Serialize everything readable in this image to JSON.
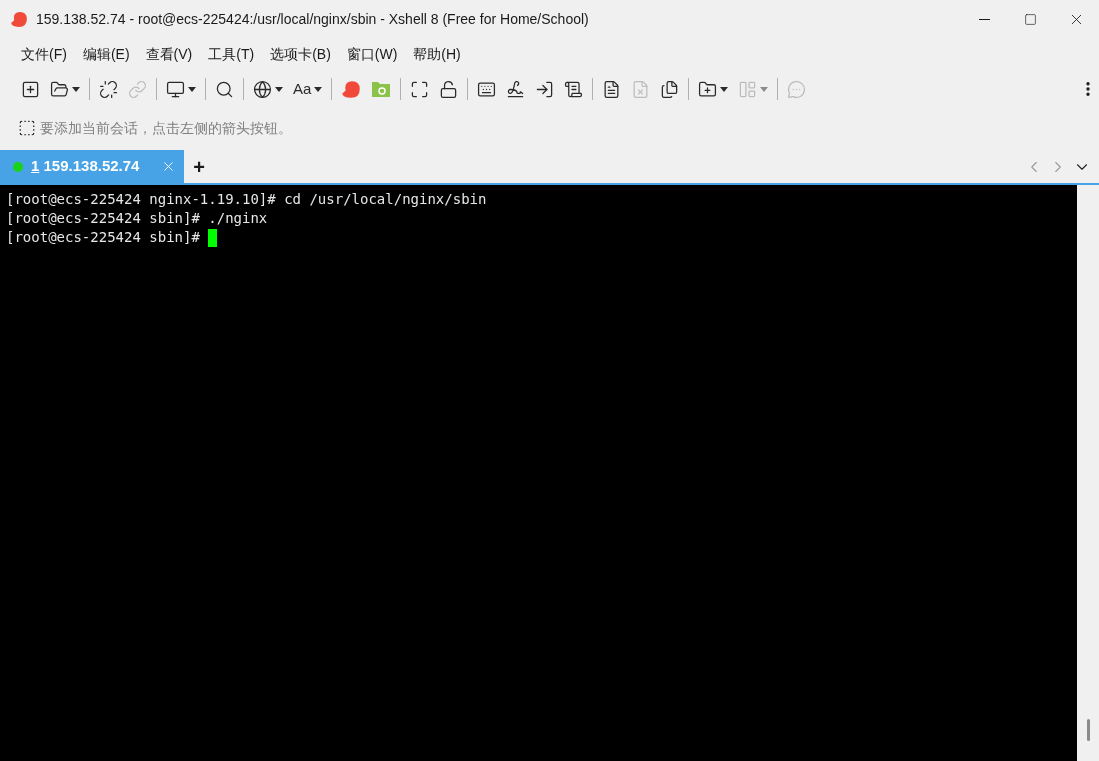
{
  "window": {
    "title": "159.138.52.74 - root@ecs-225424:/usr/local/nginx/sbin - Xshell 8 (Free for Home/School)"
  },
  "menu": [
    "文件(F)",
    "编辑(E)",
    "查看(V)",
    "工具(T)",
    "选项卡(B)",
    "窗口(W)",
    "帮助(H)"
  ],
  "toolbar": [
    [
      {
        "disabled": false,
        "dropdown": false
      },
      {
        "disabled": false,
        "dropdown": true
      }
    ],
    [
      {
        "disabled": false,
        "dropdown": false
      },
      {
        "disabled": true,
        "dropdown": false
      }
    ],
    [
      {
        "disabled": false,
        "dropdown": true
      }
    ],
    [
      {
        "disabled": false,
        "dropdown": false
      }
    ],
    [
      {
        "disabled": false,
        "dropdown": true
      },
      {
        "disabled": false,
        "dropdown": true,
        "label": "Aa"
      }
    ],
    [
      {
        "disabled": false,
        "dropdown": false
      },
      {
        "disabled": false,
        "dropdown": false
      }
    ],
    [
      {
        "disabled": false,
        "dropdown": false
      },
      {
        "disabled": false,
        "dropdown": false
      }
    ],
    [
      {
        "disabled": false,
        "dropdown": false
      },
      {
        "disabled": false,
        "dropdown": false
      },
      {
        "disabled": false,
        "dropdown": false
      },
      {
        "disabled": false,
        "dropdown": false
      }
    ],
    [
      {
        "disabled": false,
        "dropdown": false
      },
      {
        "disabled": true,
        "dropdown": false
      },
      {
        "disabled": false,
        "dropdown": false
      }
    ],
    [
      {
        "disabled": false,
        "dropdown": true
      },
      {
        "disabled": true,
        "dropdown": true
      }
    ],
    [
      {
        "disabled": true,
        "dropdown": false
      }
    ]
  ],
  "hint": "要添加当前会话，点击左侧的箭头按钮。",
  "tabs": [
    {
      "number": "1",
      "label": "159.138.52.74",
      "selected": true,
      "connected": true
    }
  ],
  "new_tab": "+",
  "terminal": {
    "lines": [
      "[root@ecs-225424 nginx-1.19.10]# cd /usr/local/nginx/sbin",
      "[root@ecs-225424 sbin]# ./nginx",
      "[root@ecs-225424 sbin]# "
    ],
    "cursor": true
  }
}
